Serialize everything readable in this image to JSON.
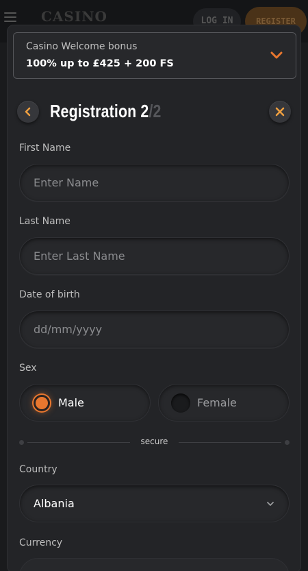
{
  "topbar": {
    "login_label": "LOG IN",
    "register_label": "REGISTER",
    "logo_text": "CASINO"
  },
  "bonus": {
    "title": "Casino Welcome bonus",
    "offer": "100% up to £425 + 200 FS"
  },
  "header": {
    "title": "Registration 2",
    "step_suffix": "/2"
  },
  "form": {
    "first_name": {
      "label": "First Name",
      "placeholder": "Enter Name"
    },
    "last_name": {
      "label": "Last Name",
      "placeholder": "Enter Last Name"
    },
    "dob": {
      "label": "Date of birth",
      "placeholder": "dd/mm/yyyy"
    },
    "sex": {
      "label": "Sex",
      "male": "Male",
      "female": "Female",
      "selected": "male"
    },
    "secure_label": "secure",
    "country": {
      "label": "Country",
      "value": "Albania"
    },
    "currency": {
      "label": "Currency"
    }
  },
  "colors": {
    "accent": "#e8772f",
    "background": "#232427"
  }
}
